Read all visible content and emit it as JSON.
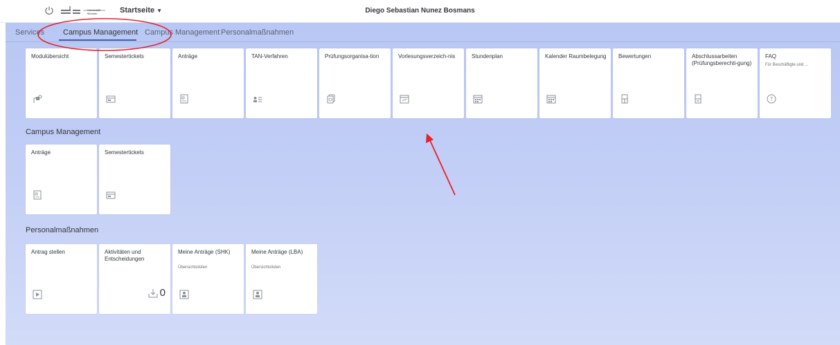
{
  "shell": {
    "home_label": "Startseite",
    "user_name": "Diego Sebastian Nunez Bosmans",
    "logo_text": "Universität Münster"
  },
  "tabs": [
    {
      "label": "Services"
    },
    {
      "label": "Campus Management"
    },
    {
      "label": "Campus Management"
    },
    {
      "label": "Personalmaßnahmen"
    }
  ],
  "services_tiles": [
    {
      "title": "Modulübersicht",
      "icon": "module-icon"
    },
    {
      "title": "Semestertickets",
      "icon": "ticket-icon"
    },
    {
      "title": "Anträge",
      "icon": "document-icon"
    },
    {
      "title": "TAN-Verfahren",
      "icon": "key-icon"
    },
    {
      "title": "Prüfungsorganisa-tion",
      "icon": "exam-icon"
    },
    {
      "title": "Vorlesungsverzeich-nis",
      "icon": "calendar-icon"
    },
    {
      "title": "Stundenplan",
      "icon": "calendar-grid-icon"
    },
    {
      "title": "Kalender Raumbelegung",
      "icon": "calendar-grid-icon"
    },
    {
      "title": "Bewertungen",
      "icon": "form-icon"
    },
    {
      "title": "Abschlussarbeiten (Prüfungsberechti-gung)",
      "icon": "form-icon"
    },
    {
      "title": "FAQ",
      "subtitle": "Für Beschäftigte und ...",
      "icon": "help-icon"
    }
  ],
  "sections": {
    "campus_title": "Campus Management",
    "personal_title": "Personalmaßnahmen"
  },
  "campus_tiles": [
    {
      "title": "Anträge",
      "icon": "document-icon"
    },
    {
      "title": "Semestertickets",
      "icon": "ticket-icon"
    }
  ],
  "personal_tiles": [
    {
      "title": "Antrag stellen",
      "icon": "play-icon"
    },
    {
      "title": "Aktivitäten und Entscheidungen",
      "count": "0",
      "icon": "inbox-icon"
    },
    {
      "title": "Meine Anträge (SHK)",
      "subtitle": "Übersichtslisten",
      "icon": "person-doc-icon"
    },
    {
      "title": "Meine Anträge (LBA)",
      "subtitle": "Übersichtslisten",
      "icon": "person-doc-icon"
    }
  ],
  "colors": {
    "annotation_red": "#e8202a",
    "background": "#c3cff6",
    "icon_gray": "#8a8f99"
  }
}
